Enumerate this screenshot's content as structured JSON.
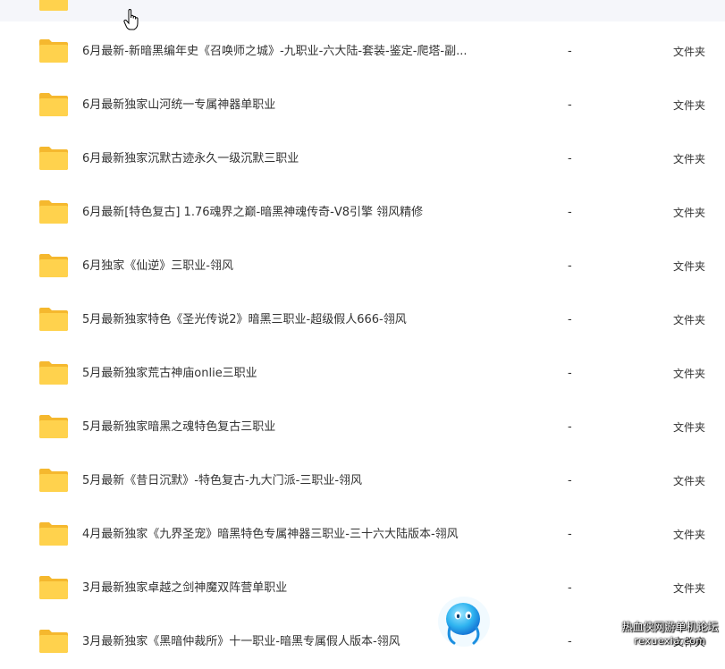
{
  "files": [
    {
      "name": "6月最新-新暗黑编年史《召唤师之城》-九职业-六大陆-套装-鉴定-爬塔-副...",
      "size": "-",
      "type": "文件夹"
    },
    {
      "name": "6月最新独家山河统一专属神器单职业",
      "size": "-",
      "type": "文件夹"
    },
    {
      "name": "6月最新独家沉默古迹永久一级沉默三职业",
      "size": "-",
      "type": "文件夹"
    },
    {
      "name": "6月最新[特色复古] 1.76魂界之巅-暗黑神魂传奇-V8引擎 翎风精修",
      "size": "-",
      "type": "文件夹"
    },
    {
      "name": "6月独家《仙逆》三职业-翎风",
      "size": "-",
      "type": "文件夹"
    },
    {
      "name": "5月最新独家特色《圣光传说2》暗黑三职业-超级假人666-翎风",
      "size": "-",
      "type": "文件夹"
    },
    {
      "name": "5月最新独家荒古神庙onlie三职业",
      "size": "-",
      "type": "文件夹"
    },
    {
      "name": "5月最新独家暗黑之魂特色复古三职业",
      "size": "-",
      "type": "文件夹"
    },
    {
      "name": "5月最新《昔日沉默》-特色复古-九大门派-三职业-翎风",
      "size": "-",
      "type": "文件夹"
    },
    {
      "name": "4月最新独家《九界圣宠》暗黑特色专属神器三职业-三十六大陆版本-翎风",
      "size": "-",
      "type": "文件夹"
    },
    {
      "name": "3月最新独家卓越之剑神魔双阵营单职业",
      "size": "-",
      "type": "文件夹"
    },
    {
      "name": "3月最新独家《黑暗仲裁所》十一职业-暗黑专属假人版本-翎风",
      "size": "-",
      "type": "文件夹"
    }
  ],
  "watermark": {
    "line1": "热血侠网游单机论坛",
    "line2": "rexuexia.com"
  },
  "icons": {
    "folder": "folder-icon",
    "cursor": "hand-cursor-icon",
    "mascot": "mascot-icon"
  },
  "colors": {
    "folder_body": "#ffd24d",
    "folder_tab": "#f5b82e",
    "strip_bg": "#f5f6fa"
  }
}
